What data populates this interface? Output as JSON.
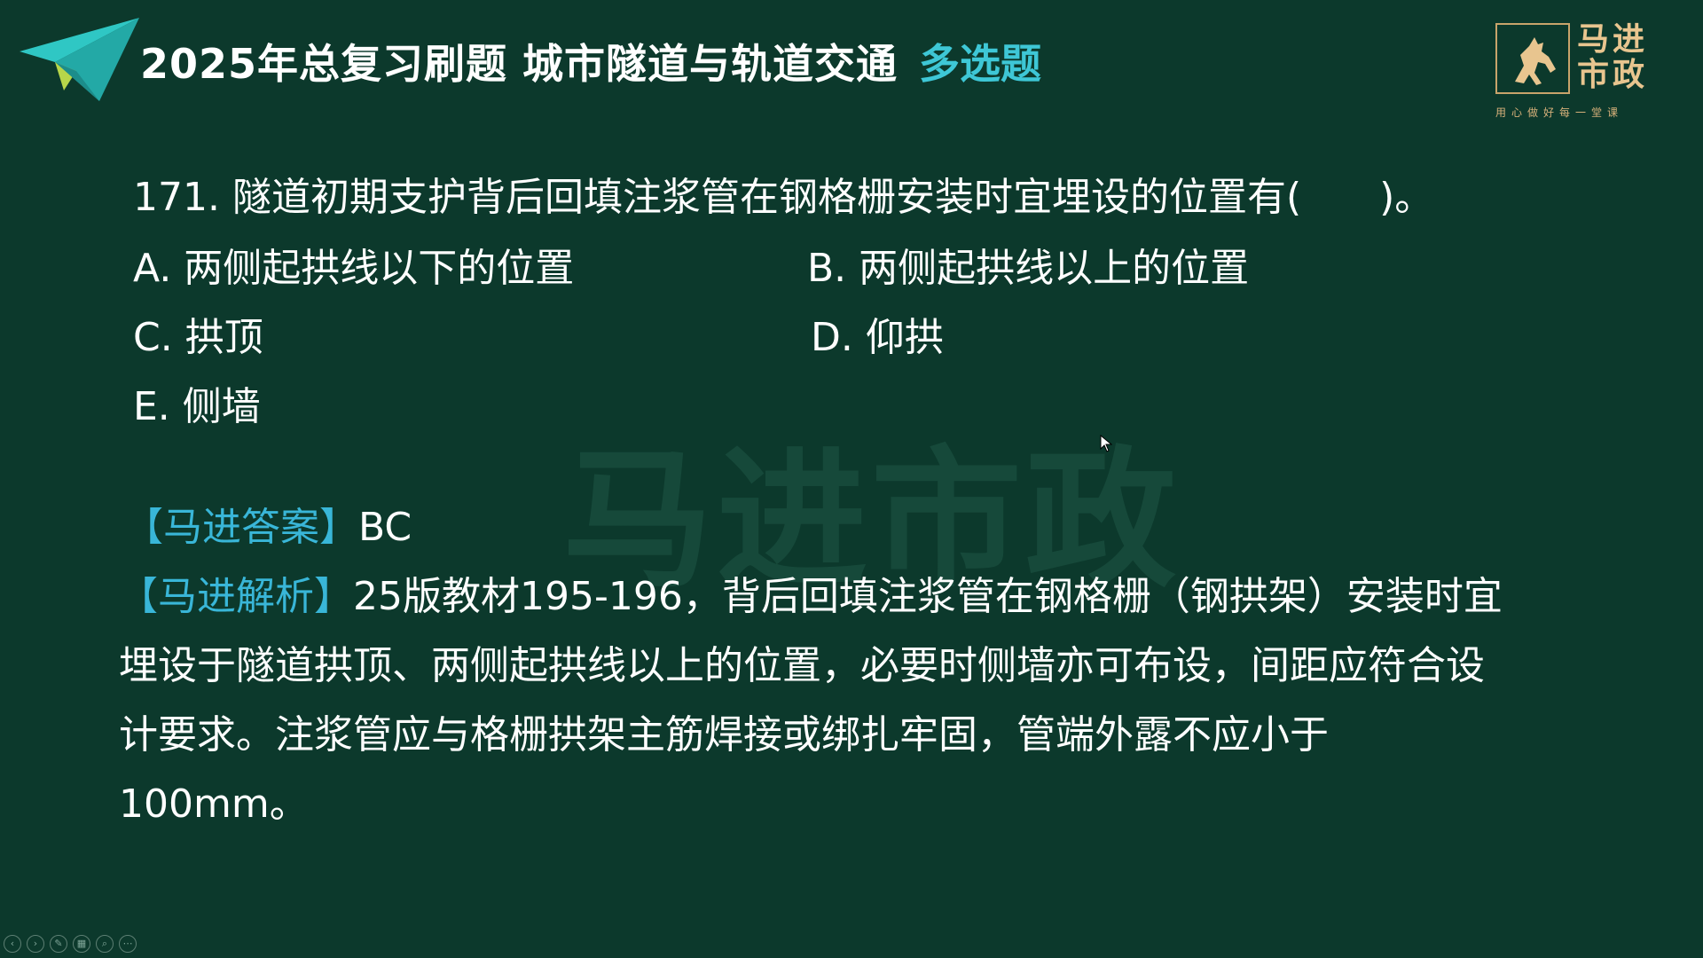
{
  "header": {
    "title": "2025年总复习刷题 城市隧道与轨道交通",
    "type_label": "多选题"
  },
  "logo": {
    "name_line1": "马进",
    "name_line2": "市政",
    "slogan": "用心做好每一堂课"
  },
  "watermark": "马进市政",
  "question": {
    "stem": "171. 隧道初期支护背后回填注浆管在钢格栅安装时宜埋设的位置有(　　)。",
    "options": [
      "A. 两侧起拱线以下的位置",
      "B. 两侧起拱线以上的位置",
      "C. 拱顶",
      "D. 仰拱",
      "E. 侧墙"
    ]
  },
  "answer": {
    "label": "【马进答案】",
    "value": "BC"
  },
  "analysis": {
    "label": "【马进解析】",
    "text": "25版教材195-196，背后回填注浆管在钢格栅（钢拱架）安装时宜埋设于隧道拱顶、两侧起拱线以上的位置，必要时侧墙亦可布设，间距应符合设计要求。注浆管应与格栅拱架主筋焊接或绑扎牢固，管端外露不应小于100mm。"
  },
  "colors": {
    "background": "#0c392c",
    "accent_cyan": "#3ec7d6",
    "label_blue": "#39b6d8",
    "logo_gold": "#e8c58f"
  },
  "icons": [
    "paper-plane-icon",
    "horse-logo-icon",
    "cursor-icon",
    "prev-slide-icon",
    "next-slide-icon",
    "pen-icon",
    "pages-icon",
    "zoom-icon",
    "more-icon"
  ]
}
